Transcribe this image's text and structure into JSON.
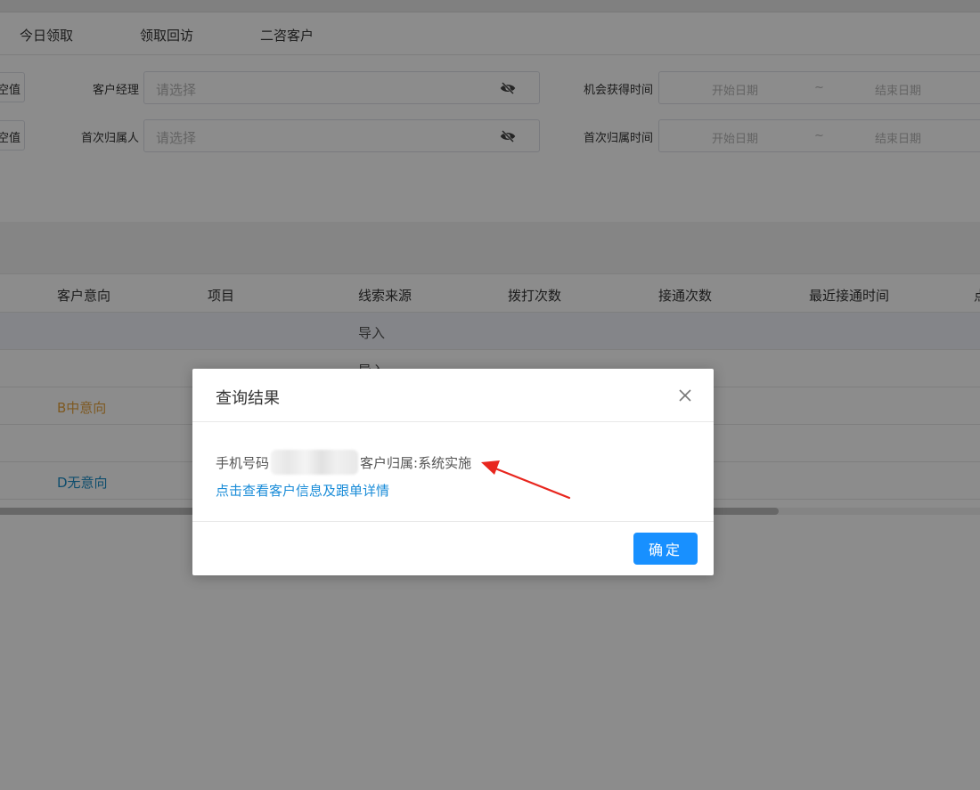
{
  "tabs": [
    "今日领取",
    "领取回访",
    "二咨客户"
  ],
  "filters": {
    "cut_button_label": "空值",
    "row1": {
      "label": "客户经理",
      "placeholder": "请选择",
      "date_label": "机会获得时间",
      "start": "开始日期",
      "sep": "~",
      "end": "结束日期"
    },
    "row2": {
      "label": "首次归属人",
      "placeholder": "请选择",
      "date_label": "首次归属时间",
      "start": "开始日期",
      "sep": "~",
      "end": "结束日期"
    }
  },
  "table": {
    "headers": [
      "客户意向",
      "项目",
      "线索来源",
      "拨打次数",
      "接通次数",
      "最近接通时间",
      "点"
    ],
    "rows": [
      {
        "intent": "",
        "source": "导入"
      },
      {
        "intent": "",
        "source": "导入"
      },
      {
        "intent": "B中意向",
        "source": ""
      },
      {
        "intent": "",
        "source": ""
      },
      {
        "intent": "D无意向",
        "source": ""
      }
    ]
  },
  "dialog": {
    "title": "查询结果",
    "phone_label": "手机号码",
    "owner_text": "客户归属:系统实施",
    "link_text": "点击查看客户信息及跟单详情",
    "ok_label": "确定"
  },
  "colors": {
    "primary": "#1890ff",
    "link": "#1a8cd8",
    "orange": "#e6a23c",
    "teal": "#1a8cc7",
    "arrow": "#e8261e"
  }
}
